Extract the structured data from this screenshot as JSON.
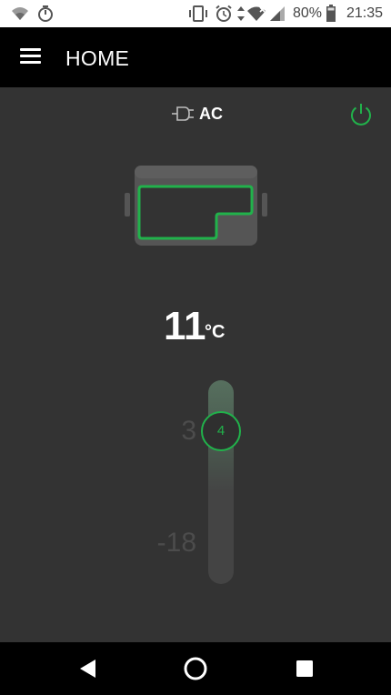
{
  "status_bar": {
    "battery_percent": "80%",
    "time": "21:35",
    "icons": [
      "wifi-signal-icon",
      "stopwatch-icon",
      "vibrate-icon",
      "alarm-icon",
      "data-arrows-icon",
      "wifi-icon",
      "cell-signal-icon",
      "battery-icon"
    ]
  },
  "app_bar": {
    "title": "HOME",
    "menu_icon": "hamburger-menu-icon"
  },
  "power": {
    "source_label": "AC",
    "source_icon": "plug-icon",
    "power_icon": "power-icon"
  },
  "temperature": {
    "value": "11",
    "unit": "°C"
  },
  "slider": {
    "max_label": "3",
    "min_label": "-18",
    "level_label": "4",
    "level_fraction": 0.11
  },
  "colors": {
    "accent_green": "#21b24b",
    "background": "#333333",
    "bar_black": "#000000"
  },
  "nav": {
    "icons": [
      "back-icon",
      "home-icon",
      "recents-icon"
    ]
  }
}
